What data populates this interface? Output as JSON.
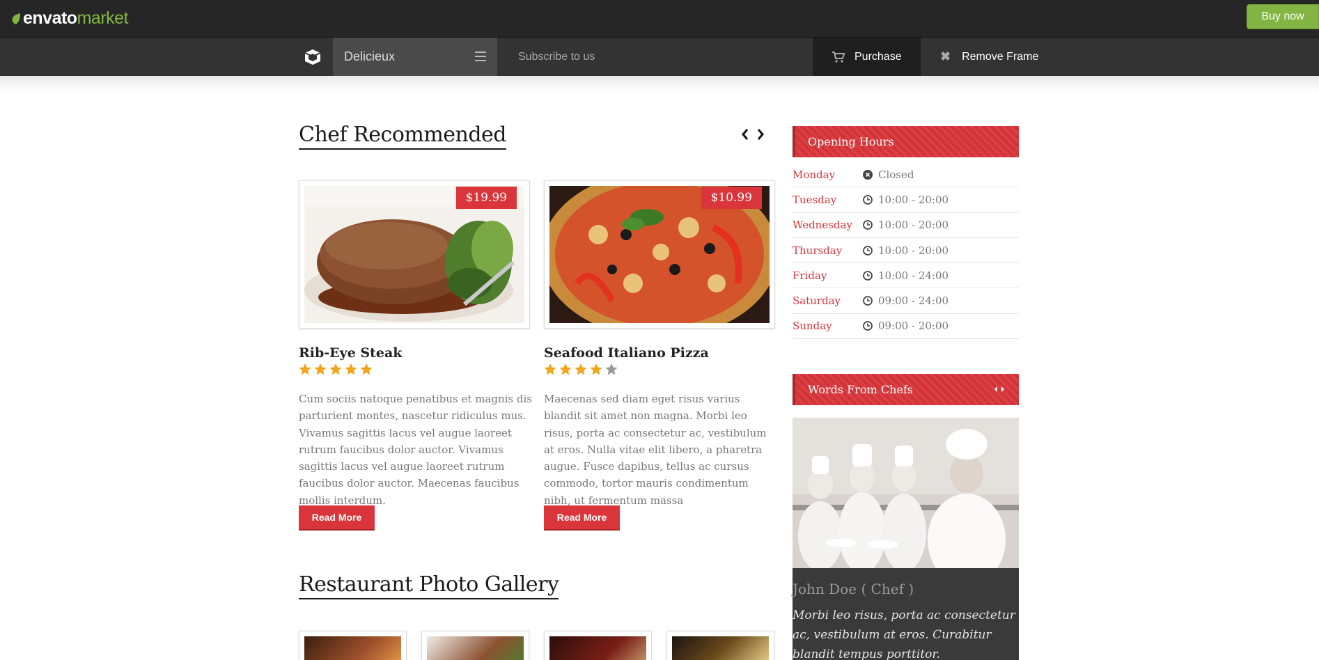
{
  "envato": {
    "logo_env": "envato",
    "logo_market": "market",
    "buy_now": "Buy now"
  },
  "demo_bar": {
    "theme_name": "Delicieux",
    "subscribe": "Subscribe to us",
    "purchase": "Purchase",
    "remove_frame": "Remove Frame"
  },
  "main": {
    "chef_title": "Chef Recommended",
    "items": [
      {
        "name": "Rib-Eye Steak",
        "price": "$19.99",
        "rating": 5,
        "description": "Cum sociis natoque penatibus et magnis dis parturient montes, nascetur ridiculus mus. Vivamus sagittis lacus vel augue laoreet rutrum faucibus dolor auctor. Vivamus sagittis lacus vel augue laoreet rutrum faucibus dolor auctor. Maecenas faucibus mollis interdum.",
        "button": "Read More"
      },
      {
        "name": "Seafood Italiano Pizza",
        "price": "$10.99",
        "rating": 4,
        "description": "Maecenas sed diam eget risus varius blandit sit amet non magna. Morbi leo risus, porta ac consectetur ac, vestibulum at eros. Nulla vitae elit libero, a pharetra augue. Fusce dapibus, tellus ac cursus commodo, tortor mauris condimentum nibh, ut fermentum massa",
        "button": "Read More"
      }
    ],
    "gallery_title": "Restaurant Photo Gallery"
  },
  "sidebar": {
    "hours_title": "Opening Hours",
    "hours": [
      {
        "day": "Monday",
        "time": "Closed",
        "icon": "closed-icon"
      },
      {
        "day": "Tuesday",
        "time": "10:00 - 20:00",
        "icon": "clock-icon"
      },
      {
        "day": "Wednesday",
        "time": "10:00 - 20:00",
        "icon": "clock-icon"
      },
      {
        "day": "Thursday",
        "time": "10:00 - 20:00",
        "icon": "clock-icon"
      },
      {
        "day": "Friday",
        "time": "10:00 - 24:00",
        "icon": "clock-icon"
      },
      {
        "day": "Saturday",
        "time": "09:00 - 24:00",
        "icon": "clock-icon"
      },
      {
        "day": "Sunday",
        "time": "09:00 - 20:00",
        "icon": "clock-icon"
      }
    ],
    "chefs_title": "Words From Chefs",
    "chef_name": "John Doe ( Chef )",
    "chef_quote": "Morbi leo risus, porta ac consectetur ac, vestibulum at eros. Curabitur blandit tempus porttitor."
  },
  "colors": {
    "accent": "#d9353a",
    "envato_green": "#82b541",
    "dark_bar": "#333333",
    "text_gray": "#777777"
  }
}
